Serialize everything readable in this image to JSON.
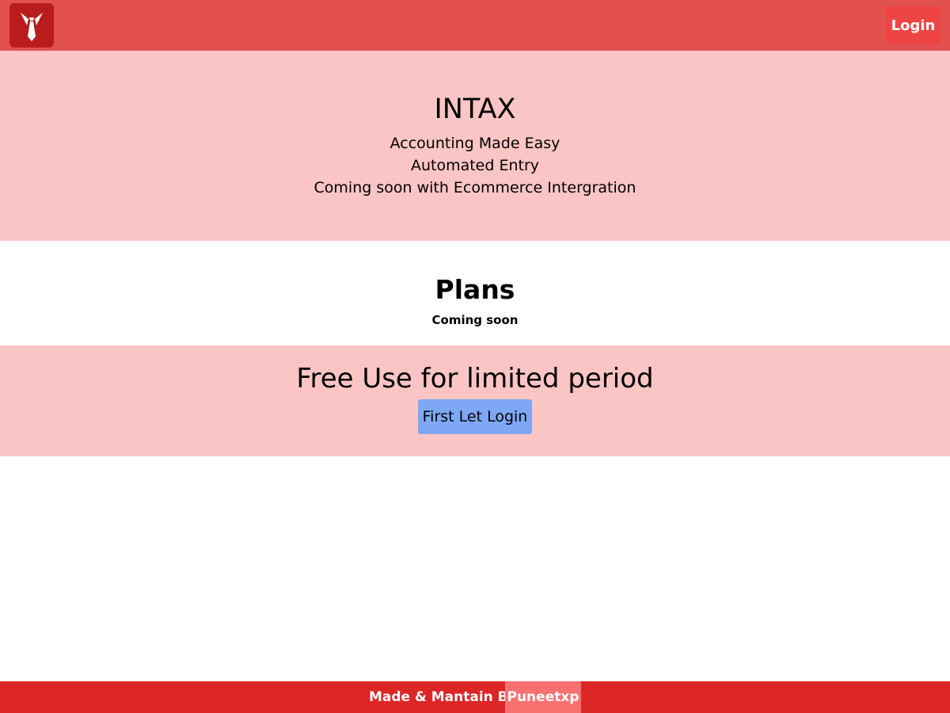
{
  "header": {
    "logo_icon": "tie-icon",
    "login_label": "Login"
  },
  "hero": {
    "title": "INTAX",
    "lines": [
      "Accounting Made Easy",
      "Automated Entry",
      "Coming soon with Ecommerce Intergration"
    ]
  },
  "plans": {
    "title": "Plans",
    "subtitle": "Coming soon"
  },
  "promo": {
    "title": "Free Use for limited period",
    "button_label": "First Let Login"
  },
  "footer": {
    "text": "Made & Mantain By",
    "author": "Puneetxp"
  },
  "colors": {
    "header_bg": "#e35050",
    "accent": "#ef4444",
    "section_bg": "#fcc5c5",
    "button_bg": "#7ea8f5",
    "footer_bg": "#dc2626"
  }
}
